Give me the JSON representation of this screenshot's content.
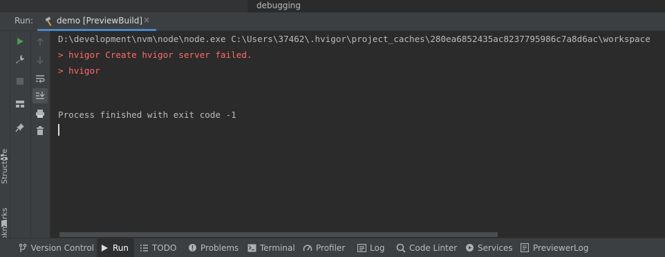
{
  "top_tab": {
    "label": "debugging"
  },
  "run_header": {
    "label": "Run:",
    "tab_label": "demo [PreviewBuild]",
    "close_glyph": "×"
  },
  "left_stripe": {
    "structure_label": "Structure",
    "bookmarks_label": "Bookmarks"
  },
  "toolbar_icons": [
    "run-icon",
    "wrench-icon",
    "stop-icon",
    "layout-icon",
    "pin-icon",
    "up-arrow-icon",
    "down-arrow-icon",
    "soft-wrap-icon",
    "scroll-to-end-icon",
    "print-icon",
    "trash-icon"
  ],
  "console": {
    "lines": [
      {
        "text": "D:\\development\\nvm\\node\\node.exe C:\\Users\\37462\\.hvigor\\project_caches\\280ea6852435ac8237795986c7a8d6ac\\workspace",
        "kind": "normal"
      },
      {
        "text": "> hvigor Create hvigor server failed.",
        "kind": "error"
      },
      {
        "text": "> hvigor",
        "kind": "error"
      },
      {
        "text": "",
        "kind": "normal"
      },
      {
        "text": "Process finished with exit code -1",
        "kind": "normal"
      }
    ]
  },
  "bottom_tools": [
    {
      "label": "Version Control",
      "icon": "branch-icon"
    },
    {
      "label": "Run",
      "icon": "run-icon",
      "active": true
    },
    {
      "label": "TODO",
      "icon": "list-icon"
    },
    {
      "label": "Problems",
      "icon": "info-icon"
    },
    {
      "label": "Terminal",
      "icon": "terminal-icon"
    },
    {
      "label": "Profiler",
      "icon": "gauge-icon"
    },
    {
      "label": "Log",
      "icon": "log-icon"
    },
    {
      "label": "Code Linter",
      "icon": "linter-icon"
    },
    {
      "label": "Services",
      "icon": "services-icon"
    },
    {
      "label": "PreviewerLog",
      "icon": "document-icon"
    }
  ],
  "colors": {
    "accent": "#4a88c7",
    "error": "#ff6b68",
    "run_green": "#499c54",
    "background": "#2b2b2b",
    "panel": "#3c3f41"
  }
}
